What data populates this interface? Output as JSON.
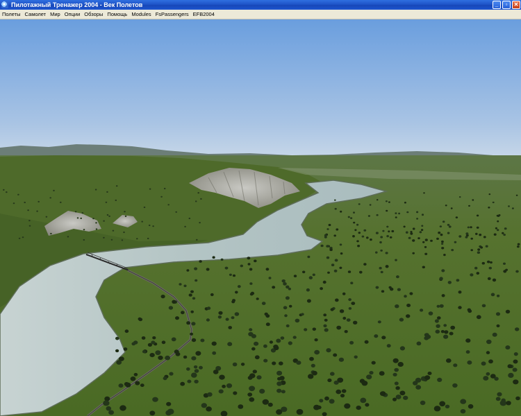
{
  "window": {
    "title": "Пилотажный Тренажер 2004 - Век Полетов",
    "minimize_glyph": "_",
    "maximize_glyph": "▫",
    "close_glyph": "✕"
  },
  "menu": {
    "items": [
      {
        "id": "flights",
        "label": "Полеты"
      },
      {
        "id": "aircraft",
        "label": "Самолет"
      },
      {
        "id": "world",
        "label": "Мир"
      },
      {
        "id": "options",
        "label": "Опции"
      },
      {
        "id": "views",
        "label": "Обзоры"
      },
      {
        "id": "help",
        "label": "Помощь"
      },
      {
        "id": "modules",
        "label": "Modules"
      },
      {
        "id": "fspassengers",
        "label": "FsPassengers"
      },
      {
        "id": "efb2004",
        "label": "EFB2004"
      }
    ]
  },
  "scene": {
    "sky_top": "#6a9ede",
    "sky_horizon": "#c7d7e8",
    "terrain": "#4a6a2c",
    "river": "#b9c9c9",
    "icon": "airplane-icon"
  }
}
